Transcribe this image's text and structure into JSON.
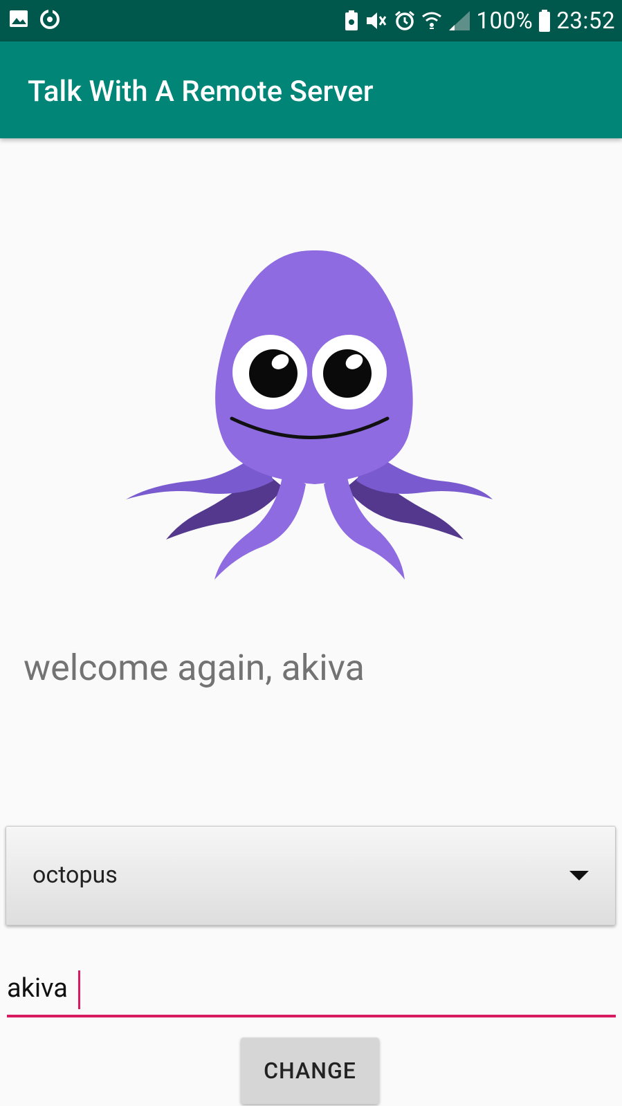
{
  "statusbar": {
    "battery_percent": "100%",
    "time": "23:52",
    "icons_left": [
      "gallery-icon",
      "sync-icon"
    ],
    "icons_right": [
      "battery-saver-icon",
      "mute-icon",
      "alarm-icon",
      "wifi-icon",
      "signal-icon",
      "battery-icon"
    ]
  },
  "appbar": {
    "title": "Talk With A Remote Server"
  },
  "main": {
    "image": "octopus-mascot",
    "welcome_text": "welcome again, akiva",
    "spinner_value": "octopus",
    "name_input_value": "akiva",
    "change_button_label": "CHANGE"
  },
  "colors": {
    "statusbar": "#00574b",
    "appbar": "#008577",
    "accent": "#d81b60",
    "octopus": "#8e6be0"
  }
}
